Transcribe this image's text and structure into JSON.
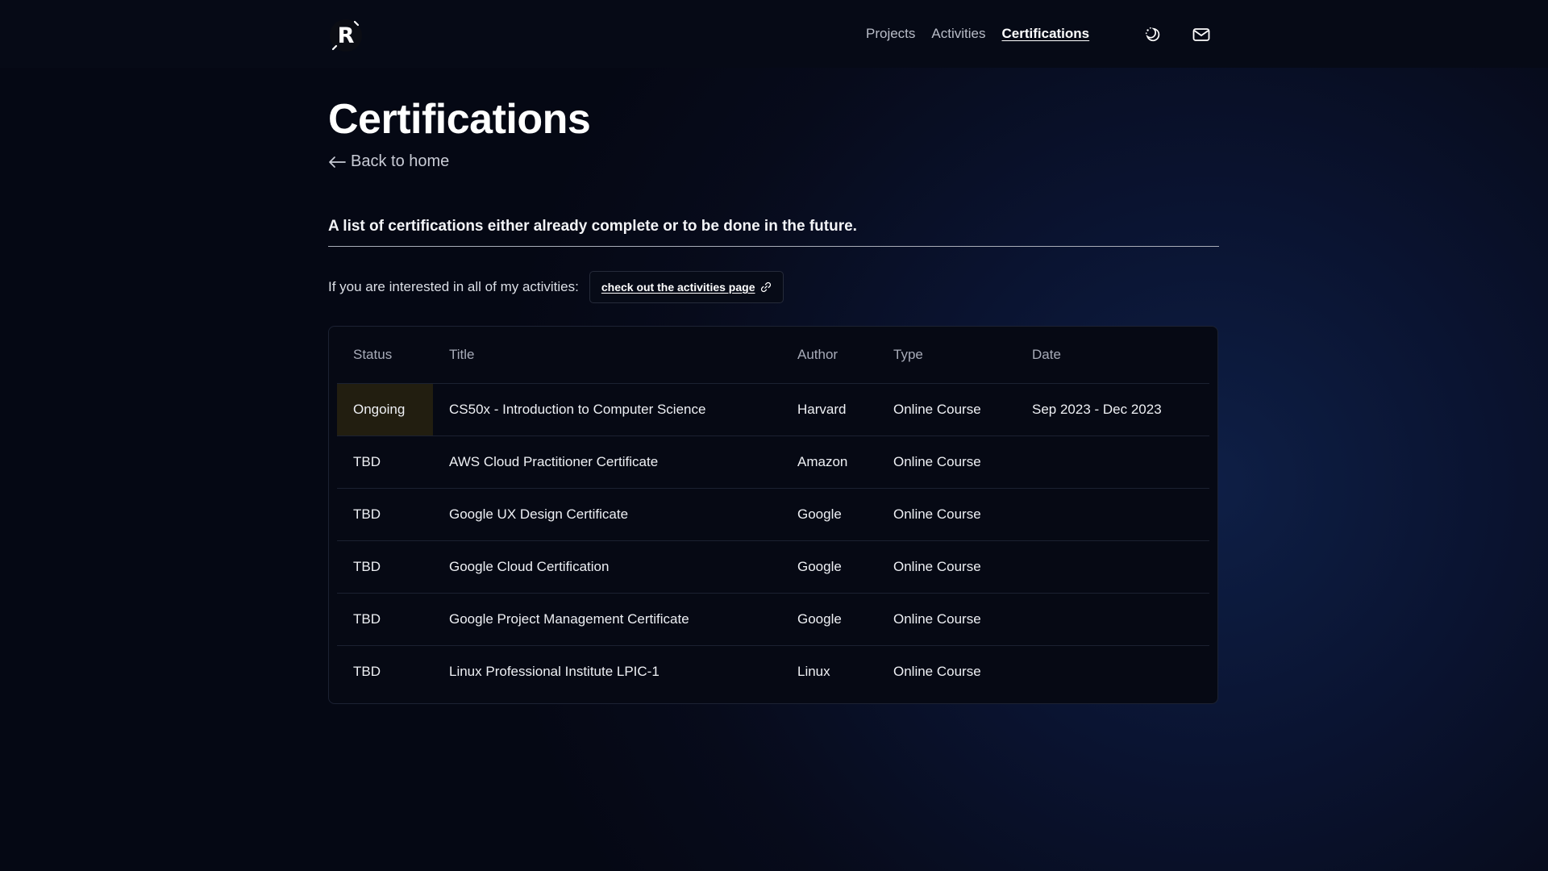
{
  "header": {
    "logo_letter": "R",
    "nav": [
      {
        "label": "Projects",
        "active": false
      },
      {
        "label": "Activities",
        "active": false
      },
      {
        "label": "Certifications",
        "active": true
      }
    ],
    "icons": [
      "theme-toggle-icon",
      "mail-icon"
    ]
  },
  "page": {
    "title": "Certifications",
    "back_label": "Back to home",
    "intro": "A list of certifications either already complete or to be done in the future.",
    "activities_prompt": "If you are interested in all of my activities:",
    "activities_link": "check out the activities page"
  },
  "table": {
    "headers": [
      "Status",
      "Title",
      "Author",
      "Type",
      "Date"
    ],
    "rows": [
      {
        "status": "Ongoing",
        "title": "CS50x - Introduction to Computer Science",
        "author": "Harvard",
        "type": "Online Course",
        "date": "Sep 2023 - Dec 2023"
      },
      {
        "status": "TBD",
        "title": "AWS Cloud Practitioner Certificate",
        "author": "Amazon",
        "type": "Online Course",
        "date": ""
      },
      {
        "status": "TBD",
        "title": "Google UX Design Certificate",
        "author": "Google",
        "type": "Online Course",
        "date": ""
      },
      {
        "status": "TBD",
        "title": "Google Cloud Certification",
        "author": "Google",
        "type": "Online Course",
        "date": ""
      },
      {
        "status": "TBD",
        "title": "Google Project Management Certificate",
        "author": "Google",
        "type": "Online Course",
        "date": ""
      },
      {
        "status": "TBD",
        "title": "Linux Professional Institute LPIC-1",
        "author": "Linux",
        "type": "Online Course",
        "date": ""
      }
    ]
  },
  "colors": {
    "background": "#070b1b",
    "ongoing_highlight": "#221e10",
    "text": "#ffffff"
  }
}
